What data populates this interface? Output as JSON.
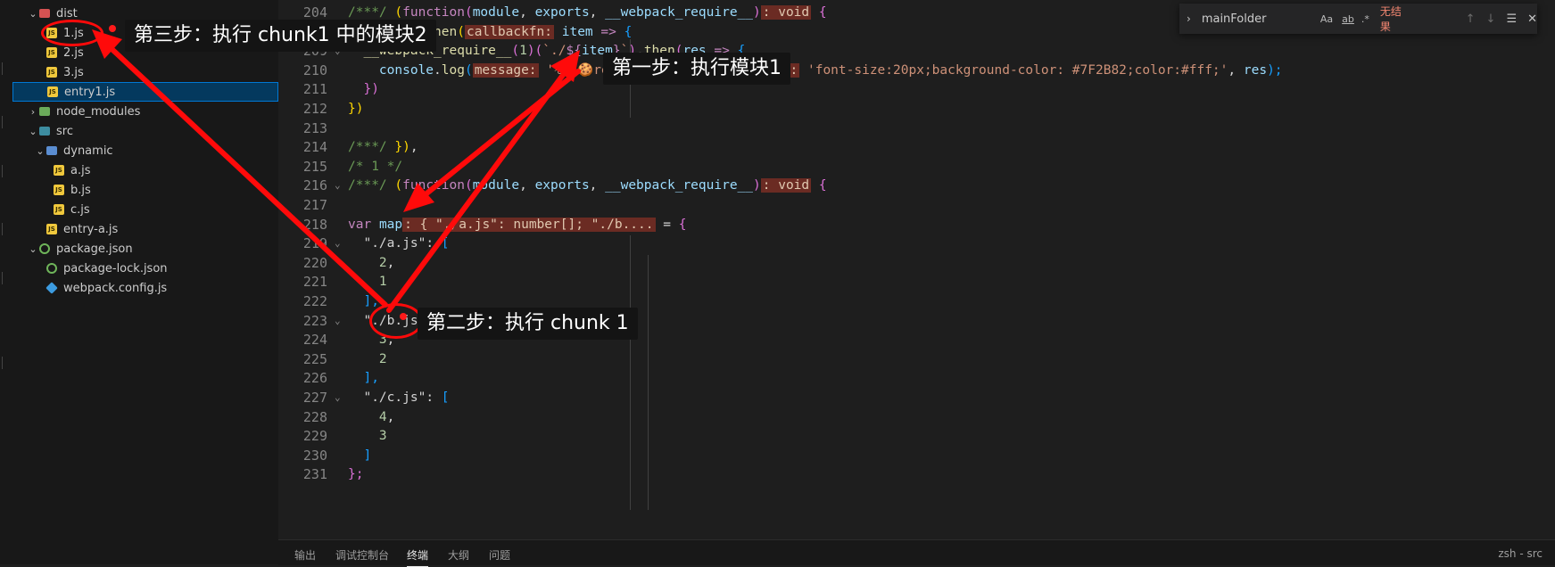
{
  "explorer": {
    "items": [
      {
        "label": "dist",
        "depth": 1,
        "chev": "⌄",
        "icon": "folder red"
      },
      {
        "label": "1.js",
        "depth": 2,
        "chev": "",
        "icon": "js"
      },
      {
        "label": "2.js",
        "depth": 2,
        "chev": "",
        "icon": "js"
      },
      {
        "label": "3.js",
        "depth": 2,
        "chev": "",
        "icon": "js"
      },
      {
        "label": "entry1.js",
        "depth": 2,
        "chev": "",
        "icon": "js",
        "selected": true
      },
      {
        "label": "node_modules",
        "depth": 1,
        "chev": "›",
        "icon": "folder green"
      },
      {
        "label": "src",
        "depth": 1,
        "chev": "⌄",
        "icon": "folder teal"
      },
      {
        "label": "dynamic",
        "depth": 2,
        "chev": "⌄",
        "icon": "folder"
      },
      {
        "label": "a.js",
        "depth": 3,
        "chev": "",
        "icon": "js"
      },
      {
        "label": "b.js",
        "depth": 3,
        "chev": "",
        "icon": "js"
      },
      {
        "label": "c.js",
        "depth": 3,
        "chev": "",
        "icon": "js"
      },
      {
        "label": "entry-a.js",
        "depth": 2,
        "chev": "",
        "icon": "js"
      },
      {
        "label": "package.json",
        "depth": 1,
        "chev": "⌄",
        "icon": "json"
      },
      {
        "label": "package-lock.json",
        "depth": 2,
        "chev": "",
        "icon": "json"
      },
      {
        "label": "webpack.config.js",
        "depth": 2,
        "chev": "",
        "icon": "cfg"
      }
    ]
  },
  "editor": {
    "lines": [
      {
        "num": "204",
        "fold": "",
        "indent": 0,
        "tokens": [
          [
            "/***/ ",
            "c-comment"
          ],
          [
            "(",
            "c-yel"
          ],
          [
            "function",
            "c-kw"
          ],
          [
            "(",
            "c-pur"
          ],
          [
            "module",
            "c-param"
          ],
          [
            ", ",
            "c-default"
          ],
          [
            "exports",
            "c-param"
          ],
          [
            ", ",
            "c-default"
          ],
          [
            "__webpack_require__",
            "c-param"
          ],
          [
            ")",
            "c-pur"
          ],
          [
            ": void",
            "hint"
          ],
          [
            " {",
            "c-pur"
          ]
        ]
      },
      {
        "num": "208",
        "fold": "",
        "indent": 0,
        "tokens": [
          [
            "  ",
            "c-default"
          ],
          [
            "Promise",
            "c-var"
          ],
          [
            ".",
            "c-default"
          ],
          [
            "then",
            "c-fn"
          ],
          [
            "(",
            "c-yel"
          ],
          [
            "callbackfn:",
            "hint"
          ],
          [
            " ",
            "c-default"
          ],
          [
            "item",
            "c-param"
          ],
          [
            " ",
            "c-default"
          ],
          [
            "=>",
            "c-kw"
          ],
          [
            " {",
            "c-blue"
          ]
        ]
      },
      {
        "num": "209",
        "fold": "⌄",
        "indent": 0,
        "tokens": [
          [
            "  ",
            "c-default"
          ],
          [
            "__webpack_require__",
            "c-fn"
          ],
          [
            "(",
            "c-pur"
          ],
          [
            "1",
            "c-num"
          ],
          [
            ")",
            "c-pur"
          ],
          [
            "(",
            "c-pur"
          ],
          [
            "`./",
            "c-str"
          ],
          [
            "${",
            "c-kw"
          ],
          [
            "item",
            "c-var"
          ],
          [
            "}",
            "c-kw"
          ],
          [
            "`",
            "c-str"
          ],
          [
            ")",
            "c-pur"
          ],
          [
            ".",
            "c-default"
          ],
          [
            "then",
            "c-fn"
          ],
          [
            "(",
            "c-pur"
          ],
          [
            "res",
            "c-param"
          ],
          [
            " => ",
            "c-kw"
          ],
          [
            "{",
            "c-blue"
          ]
        ]
      },
      {
        "num": "210",
        "fold": "",
        "indent": 0,
        "tokens": [
          [
            "    ",
            "c-default"
          ],
          [
            "console",
            "c-var"
          ],
          [
            ".",
            "c-default"
          ],
          [
            "log",
            "c-fn"
          ],
          [
            "(",
            "c-blue"
          ],
          [
            "message:",
            "hint"
          ],
          [
            " ",
            "c-default"
          ],
          [
            "'%c 🍪res: '",
            "c-str"
          ],
          [
            ", ",
            "c-default"
          ],
          [
            "...optionalParams:",
            "hint"
          ],
          [
            " ",
            "c-default"
          ],
          [
            "'font-size:20px;background-color: #7F2B82;color:#fff;'",
            "c-str"
          ],
          [
            ", ",
            "c-default"
          ],
          [
            "res",
            "c-param"
          ],
          [
            ");",
            "c-blue"
          ]
        ]
      },
      {
        "num": "211",
        "fold": "",
        "indent": 0,
        "tokens": [
          [
            "  ",
            "c-default"
          ],
          [
            "})",
            "c-pur"
          ]
        ]
      },
      {
        "num": "212",
        "fold": "",
        "indent": 0,
        "tokens": [
          [
            "})",
            "c-yel"
          ]
        ]
      },
      {
        "num": "213",
        "fold": "",
        "indent": 0,
        "tokens": []
      },
      {
        "num": "214",
        "fold": "",
        "indent": 0,
        "tokens": [
          [
            "/***/ ",
            "c-comment"
          ],
          [
            "})",
            "c-yel"
          ],
          [
            ",",
            "c-default"
          ]
        ]
      },
      {
        "num": "215",
        "fold": "",
        "indent": 0,
        "tokens": [
          [
            "/* 1 */",
            "c-comment"
          ]
        ]
      },
      {
        "num": "216",
        "fold": "⌄",
        "indent": 0,
        "tokens": [
          [
            "/***/ ",
            "c-comment"
          ],
          [
            "(",
            "c-yel"
          ],
          [
            "function",
            "c-kw"
          ],
          [
            "(",
            "c-pur"
          ],
          [
            "module",
            "c-param"
          ],
          [
            ", ",
            "c-default"
          ],
          [
            "exports",
            "c-param"
          ],
          [
            ", ",
            "c-default"
          ],
          [
            "__webpack_require__",
            "c-param"
          ],
          [
            ")",
            "c-pur"
          ],
          [
            ": void",
            "hint"
          ],
          [
            " {",
            "c-pur"
          ]
        ]
      },
      {
        "num": "217",
        "fold": "",
        "indent": 0,
        "tokens": []
      },
      {
        "num": "218",
        "fold": "",
        "indent": 0,
        "tokens": [
          [
            "var",
            "c-kw"
          ],
          [
            " ",
            "c-default"
          ],
          [
            "map",
            "c-var"
          ],
          [
            ": { \"./a.js\": number[]; \"./b....",
            "hint"
          ],
          [
            " = ",
            "c-default"
          ],
          [
            "{",
            "c-pur"
          ]
        ]
      },
      {
        "num": "219",
        "fold": "⌄",
        "indent": 0,
        "tokens": [
          [
            "  ",
            "c-default"
          ],
          [
            "\"./a.js\"",
            "c-default"
          ],
          [
            ": ",
            "c-default"
          ],
          [
            "[",
            "c-blue"
          ]
        ]
      },
      {
        "num": "220",
        "fold": "",
        "indent": 0,
        "tokens": [
          [
            "    ",
            "c-default"
          ],
          [
            "2",
            "c-num"
          ],
          [
            ",",
            "c-default"
          ]
        ]
      },
      {
        "num": "221",
        "fold": "",
        "indent": 0,
        "tokens": [
          [
            "    ",
            "c-default"
          ],
          [
            "1",
            "c-num"
          ]
        ]
      },
      {
        "num": "222",
        "fold": "",
        "indent": 0,
        "tokens": [
          [
            "  ",
            "c-default"
          ],
          [
            "],",
            "c-blue"
          ]
        ]
      },
      {
        "num": "223",
        "fold": "⌄",
        "indent": 0,
        "tokens": [
          [
            "  ",
            "c-default"
          ],
          [
            "\"./b.js\"",
            "c-default"
          ],
          [
            ": ",
            "c-default"
          ],
          [
            "[",
            "c-blue"
          ]
        ]
      },
      {
        "num": "224",
        "fold": "",
        "indent": 0,
        "tokens": [
          [
            "    ",
            "c-default"
          ],
          [
            "3",
            "c-num"
          ],
          [
            ",",
            "c-default"
          ]
        ]
      },
      {
        "num": "225",
        "fold": "",
        "indent": 0,
        "tokens": [
          [
            "    ",
            "c-default"
          ],
          [
            "2",
            "c-num"
          ]
        ]
      },
      {
        "num": "226",
        "fold": "",
        "indent": 0,
        "tokens": [
          [
            "  ",
            "c-default"
          ],
          [
            "],",
            "c-blue"
          ]
        ]
      },
      {
        "num": "227",
        "fold": "⌄",
        "indent": 0,
        "tokens": [
          [
            "  ",
            "c-default"
          ],
          [
            "\"./c.js\"",
            "c-default"
          ],
          [
            ": ",
            "c-default"
          ],
          [
            "[",
            "c-blue"
          ]
        ]
      },
      {
        "num": "228",
        "fold": "",
        "indent": 0,
        "tokens": [
          [
            "    ",
            "c-default"
          ],
          [
            "4",
            "c-num"
          ],
          [
            ",",
            "c-default"
          ]
        ]
      },
      {
        "num": "229",
        "fold": "",
        "indent": 0,
        "tokens": [
          [
            "    ",
            "c-default"
          ],
          [
            "3",
            "c-num"
          ]
        ]
      },
      {
        "num": "230",
        "fold": "",
        "indent": 0,
        "tokens": [
          [
            "  ",
            "c-default"
          ],
          [
            "]",
            "c-blue"
          ]
        ]
      },
      {
        "num": "231",
        "fold": "",
        "indent": 0,
        "tokens": [
          [
            "};",
            "c-pur"
          ]
        ]
      }
    ]
  },
  "find": {
    "query": "mainFolder",
    "match_case": "Aa",
    "whole_word": "ab",
    "regex": ".*",
    "result": "无结果"
  },
  "panel": {
    "tabs": [
      "输出",
      "调试控制台",
      "终端",
      "大纲",
      "问题"
    ],
    "active": "终端",
    "right": "zsh - src"
  },
  "annotations": {
    "step1": "第一步：执行模块1",
    "step2": "第二步：执行 chunk 1",
    "step3": "第三步：执行 chunk1 中的模块2"
  },
  "colors": {
    "annotation_red": "#ff0a0a",
    "hint_bg": "#6b2b23",
    "selected": "#04395e"
  }
}
